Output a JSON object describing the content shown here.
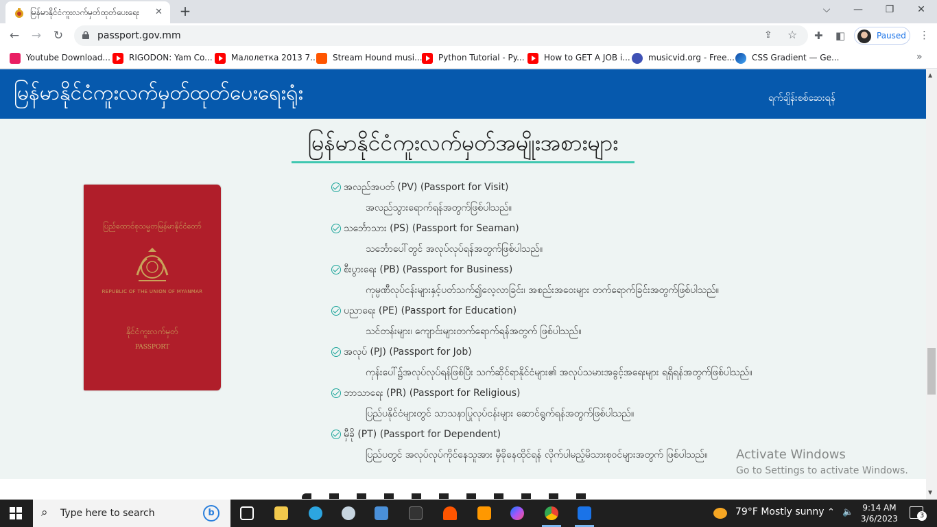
{
  "browser": {
    "tab_title": "မြန်မာနိုင်ငံကူးလက်မှတ်ထုတ်ပေးရေး",
    "tab_close": "✕",
    "new_tab": "+",
    "window_buttons": {
      "chevron": "⌵",
      "minimize": "—",
      "restore": "❐",
      "close": "✕"
    },
    "url": "passport.gov.mm",
    "profile_label": "Paused",
    "bookmarks": [
      {
        "label": "Youtube Download...",
        "icon": "download-icon",
        "color": "#e91e63"
      },
      {
        "label": "RIGODON: Yam Co...",
        "icon": "youtube-icon",
        "color": "#ff0000"
      },
      {
        "label": "Малолетка 2013 7...",
        "icon": "youtube-icon",
        "color": "#ff0000"
      },
      {
        "label": "Stream Hound musi...",
        "icon": "soundcloud-icon",
        "color": "#ff5500"
      },
      {
        "label": "Python Tutorial - Py...",
        "icon": "youtube-icon",
        "color": "#ff0000"
      },
      {
        "label": "How to GET A JOB i...",
        "icon": "youtube-icon",
        "color": "#ff0000"
      },
      {
        "label": "musicvid.org - Free...",
        "icon": "globe-icon",
        "color": "#3f51b5"
      },
      {
        "label": "CSS Gradient — Ge...",
        "icon": "css-gradient-icon",
        "color": "#1565c0"
      }
    ],
    "bookmarks_more": "»"
  },
  "site": {
    "title": "မြန်မာနိုင်ငံကူးလက်မှတ်ထုတ်ပေးရေးရုံး",
    "contact_link": "ရက်ချိန်းစစ်ဆေးရန်",
    "section_heading": "မြန်မာနိုင်ငံကူးလက်မှတ်အမျိုးအစားများ",
    "passport_cover": {
      "top_text": "ပြည်ထောင်စုသမ္မတမြန်မာနိုင်ငံတော်",
      "english_text": "REPUBLIC OF THE UNION OF MYANMAR",
      "bottom_text": "နိုင်ငံကူးလက်မှတ်",
      "passport_word": "PASSPORT"
    },
    "passport_types": [
      {
        "name": "အလည်အပတ် (PV) (Passport for Visit)",
        "desc": "အလည်သွားရောက်ရန်အတွက်ဖြစ်ပါသည်။"
      },
      {
        "name": "သင်္ဘောသား (PS) (Passport for Seaman)",
        "desc": "သင်္ဘောပေါ်တွင် အလုပ်လုပ်ရန်အတွက်ဖြစ်ပါသည်။"
      },
      {
        "name": "စီးပွားရေး (PB) (Passport for Business)",
        "desc": "ကုမ္ပဏီလုပ်ငန်းများနှင့်ပတ်သက်၍လေ့လာခြင်း၊ အစည်းအဝေးများ တက်ရောက်ခြင်းအတွက်ဖြစ်ပါသည်။"
      },
      {
        "name": "ပညာရေး (PE) (Passport for Education)",
        "desc": "သင်တန်းများ၊ ကျောင်းများတက်ရောက်ရန်အတွက် ဖြစ်ပါသည်။"
      },
      {
        "name": "အလုပ် (PJ) (Passport for Job)",
        "desc": "ကုန်းပေါ်၌အလုပ်လုပ်ရန်ဖြစ်ပြီး သက်ဆိုင်ရာနိုင်ငံများ၏ အလုပ်သမားအခွင့်အရေးများ ရရှိရန်အတွက်ဖြစ်ပါသည်။"
      },
      {
        "name": "ဘာသာရေး (PR) (Passport for Religious)",
        "desc": "ပြည်ပနိုင်ငံများတွင် သာသနာပြုလုပ်ငန်းများ ဆောင်ရွက်ရန်အတွက်ဖြစ်ပါသည်။"
      },
      {
        "name": "မှီခို (PT) (Passport for Dependent)",
        "desc": "ပြည်ပတွင် အလုပ်လုပ်ကိုင်နေသူအား မှီခိုနေထိုင်ရန် လိုက်ပါမည့်မိသားစုဝင်များအတွက် ဖြစ်ပါသည်။"
      }
    ]
  },
  "watermark": {
    "line1": "Activate Windows",
    "line2": "Go to Settings to activate Windows."
  },
  "taskbar": {
    "search_placeholder": "Type here to search",
    "apps": [
      {
        "name": "task-view",
        "color": "#ffffff"
      },
      {
        "name": "file-explorer",
        "color": "#f2c94c"
      },
      {
        "name": "telegram",
        "color": "#2ca5e0"
      },
      {
        "name": "steam",
        "color": "#1b2838"
      },
      {
        "name": "news",
        "color": "#4a90d9"
      },
      {
        "name": "live",
        "color": "#333333"
      },
      {
        "name": "soundcloud",
        "color": "#ff5500"
      },
      {
        "name": "sublime-text",
        "color": "#ff9800"
      },
      {
        "name": "messenger",
        "color": "#a855f7"
      },
      {
        "name": "chrome",
        "color": "#4285f4"
      },
      {
        "name": "badge-app",
        "color": "#1a73e8"
      }
    ],
    "weather": "79°F  Mostly sunny",
    "time": "9:14 AM",
    "date": "3/6/2023",
    "notification_count": "3"
  }
}
